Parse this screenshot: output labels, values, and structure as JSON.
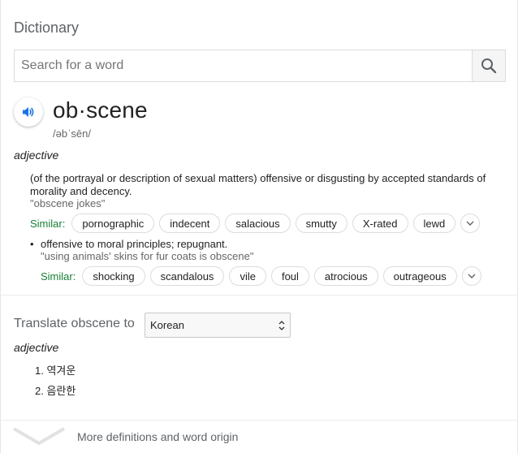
{
  "header": {
    "title": "Dictionary"
  },
  "search": {
    "placeholder": "Search for a word"
  },
  "entry": {
    "word": "ob·scene",
    "phonetic": "/əbˈsēn/",
    "part_of_speech": "adjective",
    "senses": [
      {
        "definition": "(of the portrayal or description of sexual matters) offensive or disgusting by accepted standards of morality and decency.",
        "example": "\"obscene jokes\"",
        "similar_label": "Similar:",
        "similar": [
          "pornographic",
          "indecent",
          "salacious",
          "smutty",
          "X-rated",
          "lewd"
        ]
      },
      {
        "definition": "offensive to moral principles; repugnant.",
        "example": "\"using animals' skins for fur coats is obscene\"",
        "similar_label": "Similar:",
        "similar": [
          "shocking",
          "scandalous",
          "vile",
          "foul",
          "atrocious",
          "outrageous"
        ]
      }
    ]
  },
  "translate": {
    "label": "Translate obscene to",
    "language": "Korean",
    "part_of_speech": "adjective",
    "items": [
      "1. 역겨운",
      "2. 음란한"
    ]
  },
  "footer": {
    "more_label": "More definitions and word origin"
  },
  "colors": {
    "accent": "#1a73e8",
    "similar": "#188038",
    "muted": "#5f6368"
  },
  "icons": [
    "search-icon",
    "speaker-icon",
    "chevron-down-icon",
    "select-arrows-icon",
    "expand-chevron-icon"
  ]
}
